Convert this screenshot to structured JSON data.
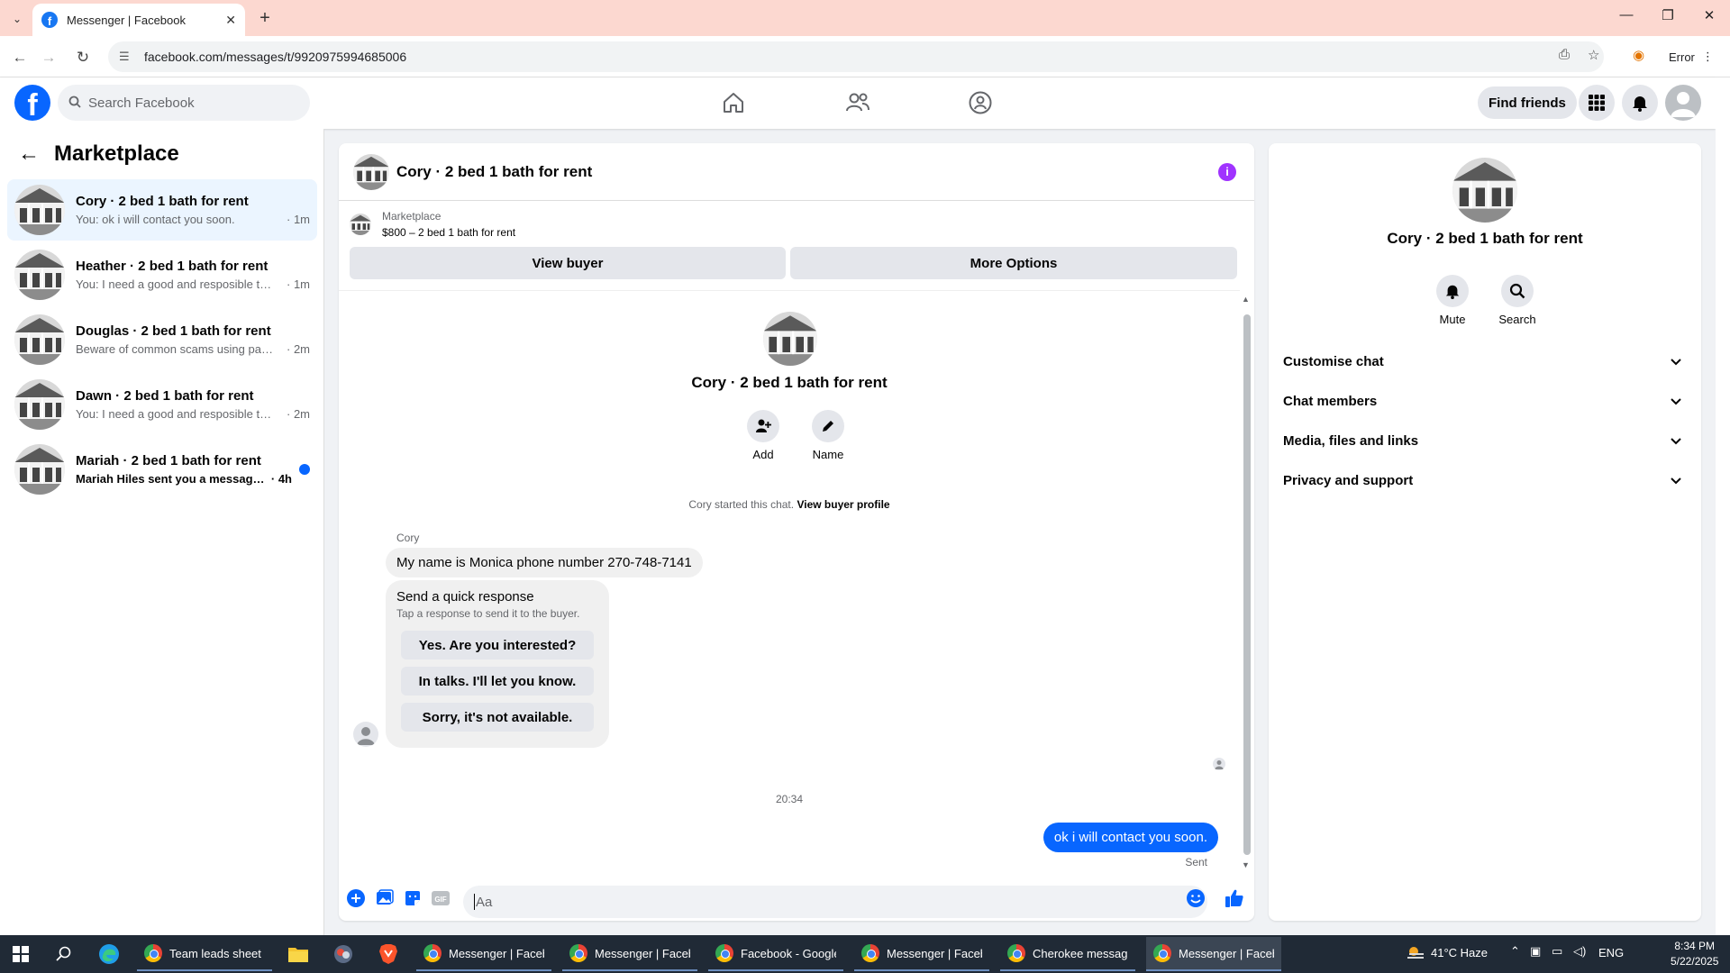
{
  "browser": {
    "tab_title": "Messenger | Facebook",
    "url": "facebook.com/messages/t/9920975994685006",
    "profile_chip": "Error"
  },
  "header": {
    "search_placeholder": "Search Facebook",
    "find_friends": "Find friends"
  },
  "sidebar": {
    "title": "Marketplace",
    "conversations": [
      {
        "name": "Cory · 2 bed 1 bath for rent",
        "preview": "You: ok i will contact you soon.",
        "time": " · 1m",
        "active": true,
        "unread": false
      },
      {
        "name": "Heather · 2 bed 1 bath for rent",
        "preview": "You: I need a good and resposible te...",
        "time": " · 1m",
        "active": false,
        "unread": false
      },
      {
        "name": "Douglas · 2 bed 1 bath for rent",
        "preview": "Beware of common scams using pay...",
        "time": " · 2m",
        "active": false,
        "unread": false
      },
      {
        "name": "Dawn · 2 bed 1 bath for rent",
        "preview": "You: I need a good and resposible te...",
        "time": " · 2m",
        "active": false,
        "unread": false
      },
      {
        "name": "Mariah · 2 bed 1 bath for rent",
        "preview": "Mariah Hiles sent you a message a...",
        "time": " · 4h",
        "active": false,
        "unread": true
      }
    ]
  },
  "chat": {
    "title": "Cory · 2 bed 1 bath for rent",
    "listing_label": "Marketplace",
    "listing_title": "$800 – 2 bed 1 bath for rent",
    "view_buyer": "View buyer",
    "more_options": "More Options",
    "intro_name": "Cory · 2 bed 1 bath for rent",
    "add_label": "Add",
    "name_label": "Name",
    "started_text": "Cory started this chat.",
    "view_buyer_profile": "View buyer profile",
    "sender": "Cory",
    "incoming_message": "My name is Monica phone number 270-748-7141",
    "quick_title": "Send a quick response",
    "quick_sub": "Tap a response to send it to the buyer.",
    "quick_responses": [
      "Yes. Are you interested?",
      "In talks. I'll let you know.",
      "Sorry, it's not available."
    ],
    "timestamp": "20:34",
    "outgoing_message": "ok i will contact you soon.",
    "sent_label": "Sent",
    "composer_placeholder": "Aa"
  },
  "details": {
    "name": "Cory · 2 bed 1 bath for rent",
    "mute": "Mute",
    "search": "Search",
    "sections": [
      "Customise chat",
      "Chat members",
      "Media, files and links",
      "Privacy and support"
    ]
  },
  "taskbar": {
    "apps": [
      {
        "label": "Team leads sheet - ...",
        "active": false
      },
      {
        "label": "Messenger | Faceb...",
        "active": false
      },
      {
        "label": "Messenger | Faceb...",
        "active": false
      },
      {
        "label": "Facebook - Google ...",
        "active": false
      },
      {
        "label": "Messenger | Faceb...",
        "active": false
      },
      {
        "label": "Cherokee message...",
        "active": false
      },
      {
        "label": "Messenger | Faceb...",
        "active": true
      }
    ],
    "weather": "41°C  Haze",
    "language": "ENG",
    "time": "8:34 PM",
    "date": "5/22/2025"
  },
  "colors": {
    "brand": "#0866ff",
    "info_button": "#a033ff"
  }
}
